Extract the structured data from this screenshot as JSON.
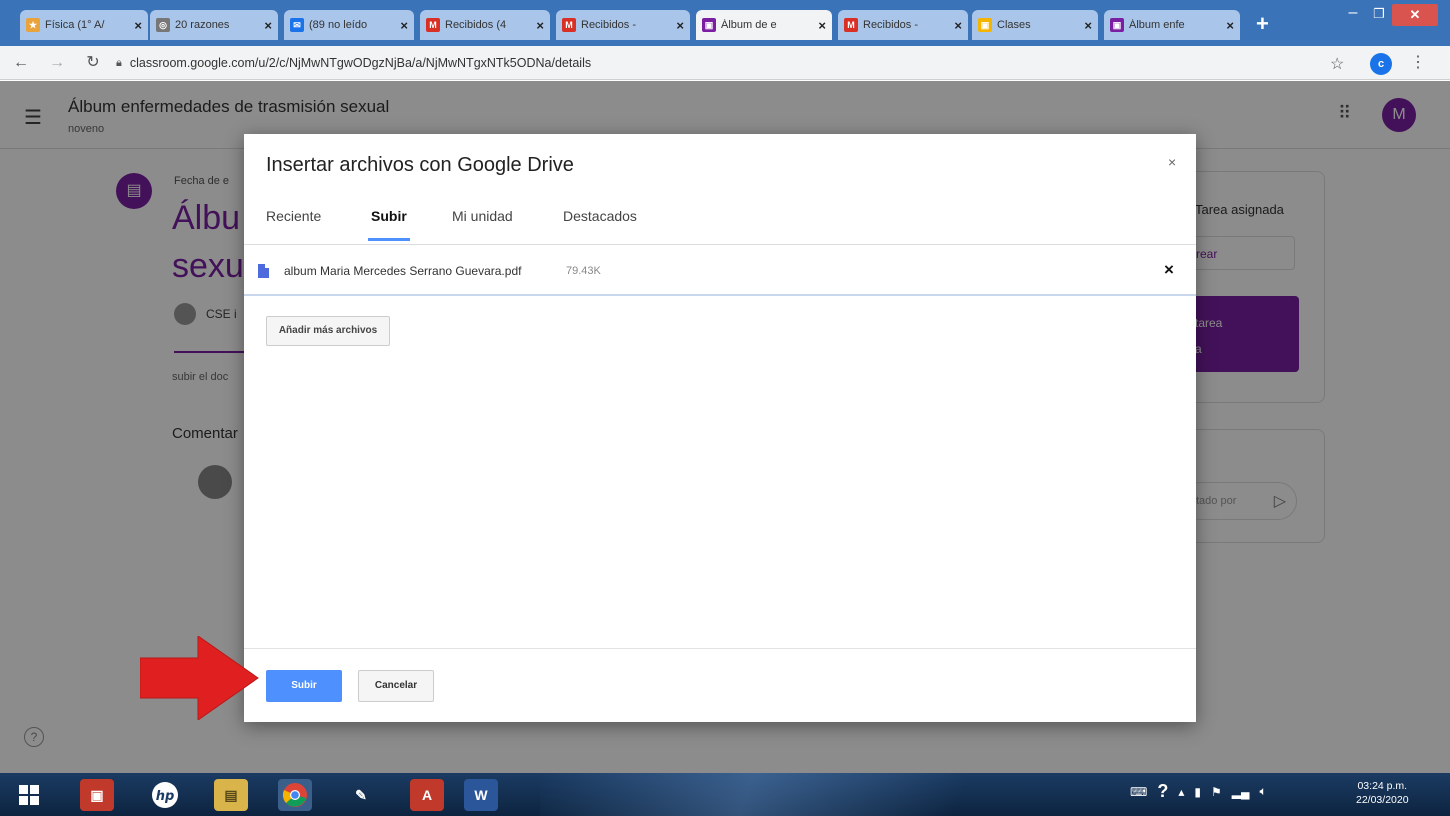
{
  "browser": {
    "tabs": [
      {
        "title": "Física (1° A/",
        "favicon_color": "#e8a33c"
      },
      {
        "title": "20 razones",
        "favicon_color": "#777777"
      },
      {
        "title": "(89 no leído",
        "favicon_color": "#1a73e8"
      },
      {
        "title": "Recibidos (4",
        "favicon_color": "#d93025"
      },
      {
        "title": "Recibidos -",
        "favicon_color": "#d93025"
      },
      {
        "title": "Álbum de e",
        "favicon_color": "#7b1fa2"
      },
      {
        "title": "Recibidos -",
        "favicon_color": "#d93025"
      },
      {
        "title": "Clases",
        "favicon_color": "#f4b400"
      },
      {
        "title": "Álbum enfe",
        "favicon_color": "#7b1fa2"
      }
    ],
    "active_tab_index": 5,
    "new_tab": "+",
    "url": "classroom.google.com/u/2/c/NjMwNTgwODgzNjBa/a/NjMwNTgxNTk5ODNa/details",
    "profile_initial": "c"
  },
  "classroom": {
    "class_title": "Álbum enfermedades de trasmisión sexual",
    "class_section": "noveno",
    "user_initial": "M",
    "due_label": "Fecha de e",
    "assignment_title_line1": "Álbu",
    "assignment_title_line2": "sexu",
    "author": "CSE i",
    "description": "subir el doc",
    "comments_heading": "Comentar",
    "right_card": {
      "status": "Tarea asignada",
      "create_label": "rear",
      "purple_line1": "tarea",
      "purple_line2": "a"
    },
    "private_comment_placeholder": "tado por"
  },
  "dialog": {
    "title": "Insertar archivos con Google Drive",
    "close": "×",
    "tabs": [
      "Reciente",
      "Subir",
      "Mi unidad",
      "Destacados"
    ],
    "selected_tab": "Subir",
    "file": {
      "name": "album Maria Mercedes Serrano Guevara.pdf",
      "size": "79.43K",
      "remove": "×"
    },
    "add_more_label": "Añadir más archivos",
    "upload_label": "Subir",
    "cancel_label": "Cancelar"
  },
  "taskbar": {
    "apps": [
      "windows-start",
      "app-1",
      "hp",
      "file-explorer",
      "chrome",
      "paint",
      "adobe-reader",
      "word"
    ],
    "time": "03:24 p.m.",
    "date": "22/03/2020"
  },
  "colors": {
    "classroom_purple": "#7b1fa2",
    "drive_blue": "#4d90fe",
    "annotation_red": "#e02020"
  }
}
